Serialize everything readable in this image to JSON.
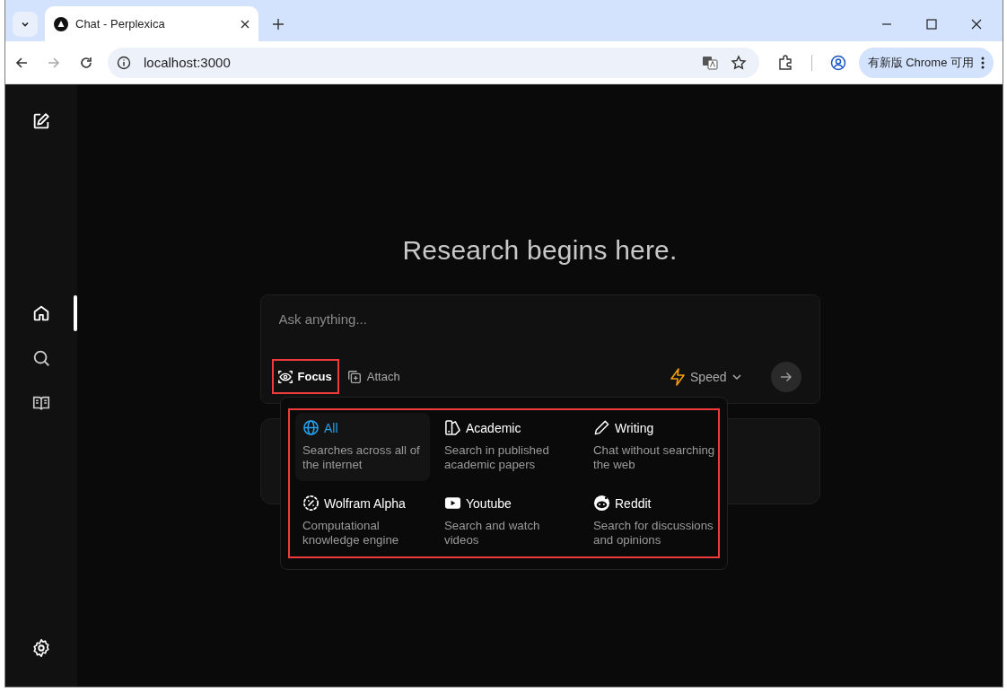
{
  "browser": {
    "tab_title": "Chat - Perplexica",
    "address": "localhost:3000",
    "update_button": "有新版 Chrome 可用"
  },
  "sidebar": {
    "items": [
      {
        "kind": "home",
        "selected": true
      },
      {
        "kind": "search",
        "selected": false
      },
      {
        "kind": "library",
        "selected": false
      }
    ]
  },
  "heading": "Research begins here.",
  "composer": {
    "placeholder": "Ask anything...",
    "focus_button": "Focus",
    "attach_button": "Attach",
    "mode_button": "Speed"
  },
  "focus_menu": {
    "options": [
      {
        "kind": "globe",
        "title": "All",
        "description": "Searches across all of the internet",
        "selected": true
      },
      {
        "kind": "book",
        "title": "Academic",
        "description": "Search in published academic papers",
        "selected": false
      },
      {
        "kind": "pencil",
        "title": "Writing",
        "description": "Chat without searching the web",
        "selected": false
      },
      {
        "kind": "percent",
        "title": "Wolfram Alpha",
        "description": "Computational knowledge engine",
        "selected": false
      },
      {
        "kind": "play",
        "title": "Youtube",
        "description": "Search and watch videos",
        "selected": false
      },
      {
        "kind": "reddit",
        "title": "Reddit",
        "description": "Search for discussions and opinions",
        "selected": false
      }
    ]
  }
}
